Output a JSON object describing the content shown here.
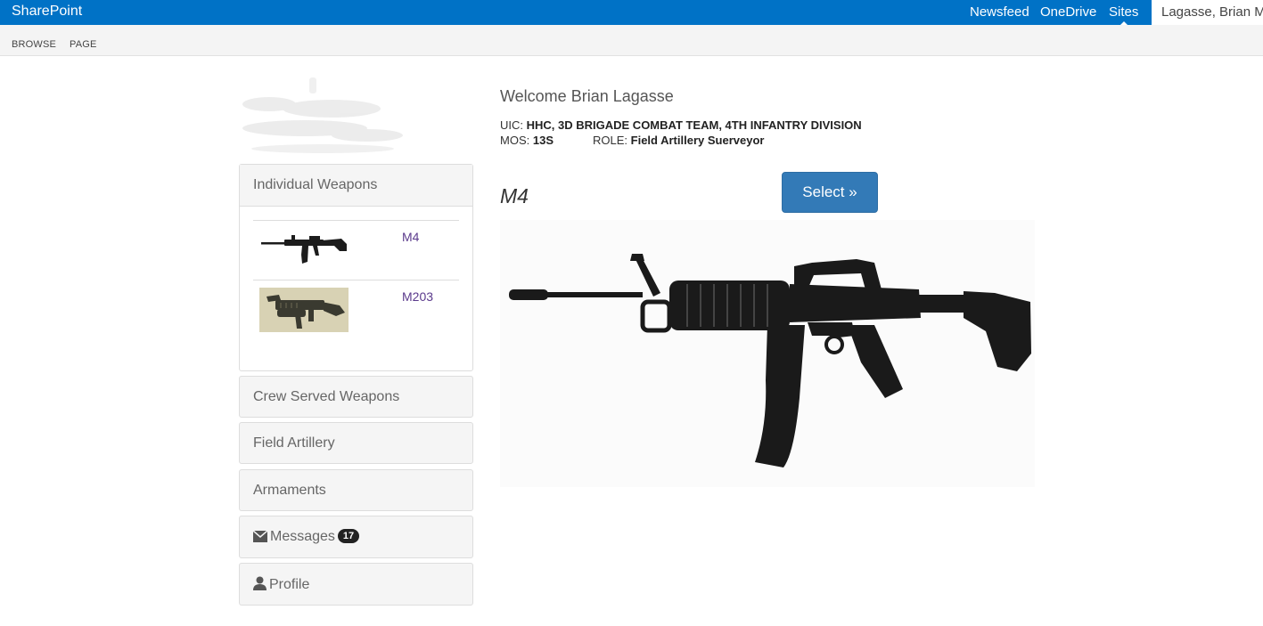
{
  "suite": {
    "brand": "SharePoint",
    "nav": [
      "Newsfeed",
      "OneDrive",
      "Sites"
    ],
    "active_nav": "Sites",
    "user": "Lagasse, Brian M"
  },
  "ribbon": {
    "tabs": [
      "BROWSE",
      "PAGE"
    ]
  },
  "sidebar": {
    "open_panel": {
      "title": "Individual Weapons",
      "items": [
        {
          "label": "M4",
          "thumb_icon": "m4-rifle-thumbnail"
        },
        {
          "label": "M203",
          "thumb_icon": "m203-grenade-launcher-thumbnail"
        }
      ]
    },
    "panels": [
      {
        "title": "Crew Served Weapons"
      },
      {
        "title": "Field Artillery"
      },
      {
        "title": "Armaments"
      },
      {
        "title": "Messages",
        "badge": "17",
        "icon": "envelope-icon"
      },
      {
        "title": "Profile",
        "icon": "user-icon"
      }
    ]
  },
  "main": {
    "welcome": "Welcome Brian Lagasse",
    "uic_label": "UIC:",
    "uic_value": "HHC, 3D BRIGADE COMBAT TEAM, 4TH INFANTRY DIVISION",
    "mos_label": "MOS:",
    "mos_value": "13S",
    "role_label": "ROLE:",
    "role_value": "Field Artillery Suerveyor",
    "weapon_title": "M4",
    "select_label": "Select »",
    "image_icon": "m4-rifle-image"
  },
  "colors": {
    "suitebar": "#0072c6",
    "button": "#337ab7",
    "link": "#5b3a8c",
    "badge": "#222222"
  }
}
